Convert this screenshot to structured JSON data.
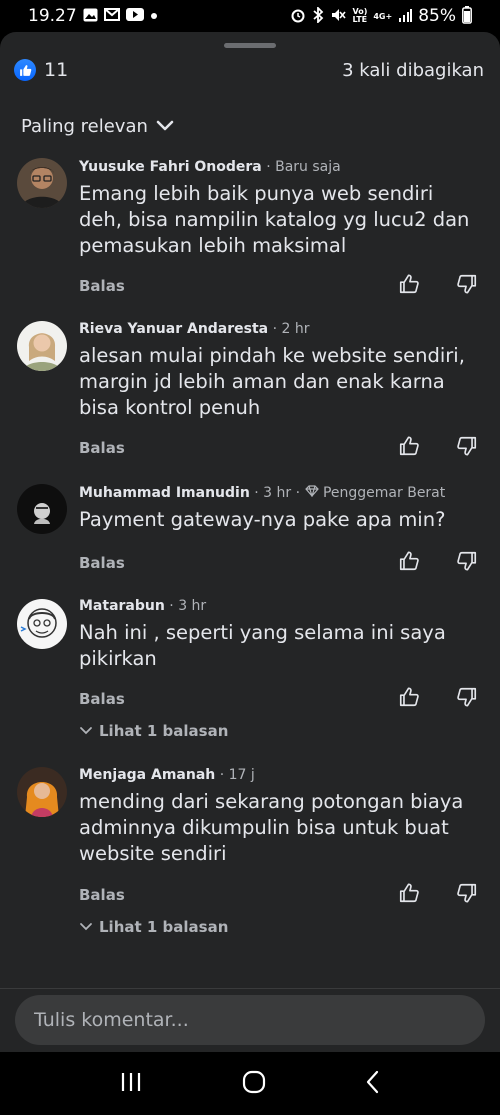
{
  "status_bar": {
    "time": "19.27",
    "volte_label": "Vo)\nLTE",
    "network_label": "4G+",
    "battery": "85%"
  },
  "reactions": {
    "count": "11",
    "icon": "thumbs-up-icon"
  },
  "shares": {
    "label": "3 kali dibagikan"
  },
  "sort": {
    "label": "Paling relevan"
  },
  "comments": [
    {
      "name": "Yuusuke Fahri Onodera",
      "time": "Baru saja",
      "badge": "",
      "text": "Emang lebih baik punya web sendiri deh, bisa nampilin katalog yg lucu2 dan pemasukan lebih maksimal",
      "reply": "Balas",
      "view_replies": ""
    },
    {
      "name": "Rieva Yanuar Andaresta",
      "time": "2 hr",
      "badge": "",
      "text": "alesan mulai pindah ke website sendiri, margin jd lebih aman dan enak karna bisa kontrol penuh",
      "reply": "Balas",
      "view_replies": ""
    },
    {
      "name": "Muhammad Imanudin",
      "time": "3 hr",
      "badge": "Penggemar Berat",
      "text": "Payment gateway-nya pake apa min?",
      "reply": "Balas",
      "view_replies": ""
    },
    {
      "name": "Matarabun",
      "time": "3 hr",
      "badge": "",
      "text": "Nah ini , seperti yang selama ini saya pikirkan",
      "reply": "Balas",
      "view_replies": "Lihat 1 balasan"
    },
    {
      "name": "Menjaga Amanah",
      "time": "17 j",
      "badge": "",
      "text": "mending dari sekarang potongan biaya adminnya dikumpulin bisa untuk buat website sendiri",
      "reply": "Balas",
      "view_replies": "Lihat 1 balasan"
    }
  ],
  "composer": {
    "placeholder": "Tulis komentar..."
  },
  "colors": {
    "sheet_bg": "#242526",
    "input_bg": "#3a3b3c",
    "text_primary": "#e4e6eb",
    "text_secondary": "#b0b3b8",
    "like_blue": "#0866ff"
  }
}
